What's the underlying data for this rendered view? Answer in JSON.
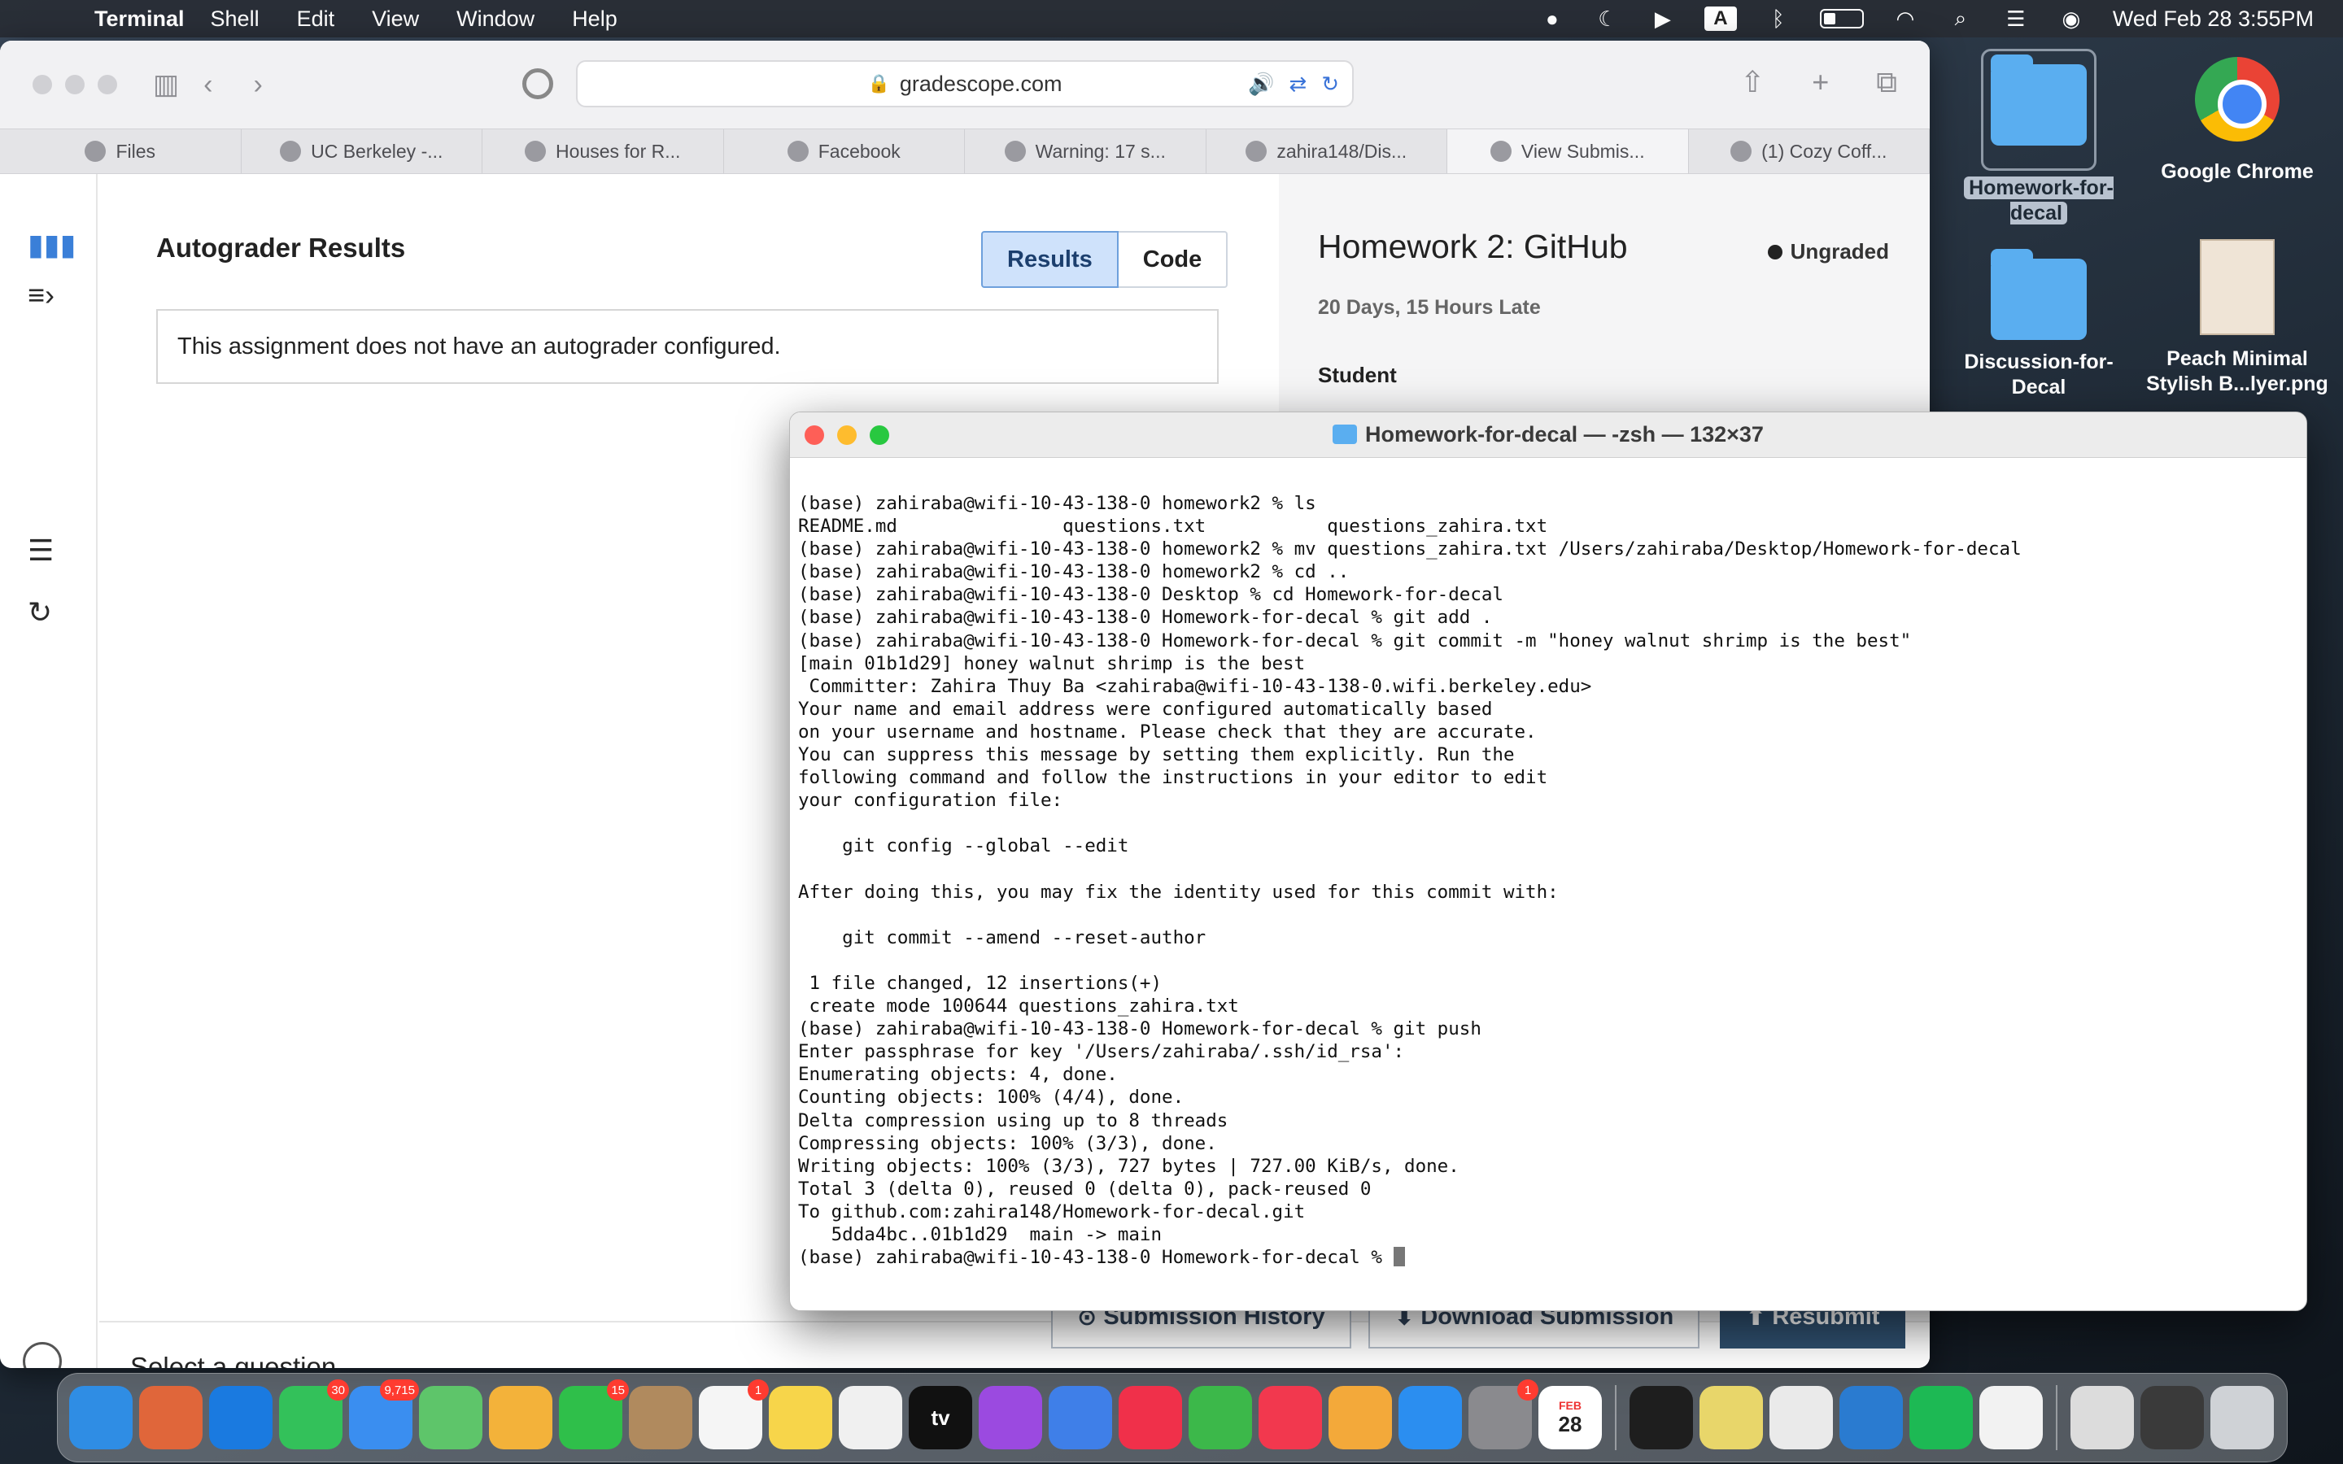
{
  "menubar": {
    "app_name": "Terminal",
    "menus": [
      "Shell",
      "Edit",
      "View",
      "Window",
      "Help"
    ],
    "clock": "Wed Feb 28  3:55PM"
  },
  "browser": {
    "url": "gradescope.com",
    "tabs": [
      "Files",
      "UC Berkeley -...",
      "Houses for R...",
      "Facebook",
      "Warning: 17 s...",
      "zahira148/Dis...",
      "View Submis...",
      "(1) Cozy Coff..."
    ]
  },
  "gradescope": {
    "autograder_heading": "Autograder Results",
    "results_tab": "Results",
    "code_tab": "Code",
    "notice": "This assignment does not have an autograder configured.",
    "homework_title": "Homework 2: GitHub",
    "grade_status": "Ungraded",
    "late_text": "20 Days, 15 Hours Late",
    "student_label": "Student",
    "select_question": "Select a question.",
    "submission_history": "Submission History",
    "download_submission": "Download Submission",
    "resubmit": "Resubmit"
  },
  "desktop": {
    "icons": [
      {
        "label": "Homework-for-decal"
      },
      {
        "label": "Google Chrome"
      },
      {
        "label": "Discussion-for-Decal"
      },
      {
        "label": "Peach Minimal Stylish B...lyer.png"
      }
    ]
  },
  "terminal": {
    "title": "Homework-for-decal — -zsh — 132×37",
    "lines": [
      "(base) zahiraba@wifi-10-43-138-0 homework2 % ls",
      "README.md               questions.txt           questions_zahira.txt",
      "(base) zahiraba@wifi-10-43-138-0 homework2 % mv questions_zahira.txt /Users/zahiraba/Desktop/Homework-for-decal",
      "(base) zahiraba@wifi-10-43-138-0 homework2 % cd ..",
      "(base) zahiraba@wifi-10-43-138-0 Desktop % cd Homework-for-decal",
      "(base) zahiraba@wifi-10-43-138-0 Homework-for-decal % git add .",
      "(base) zahiraba@wifi-10-43-138-0 Homework-for-decal % git commit -m \"honey walnut shrimp is the best\"",
      "[main 01b1d29] honey walnut shrimp is the best",
      " Committer: Zahira Thuy Ba <zahiraba@wifi-10-43-138-0.wifi.berkeley.edu>",
      "Your name and email address were configured automatically based",
      "on your username and hostname. Please check that they are accurate.",
      "You can suppress this message by setting them explicitly. Run the",
      "following command and follow the instructions in your editor to edit",
      "your configuration file:",
      "",
      "    git config --global --edit",
      "",
      "After doing this, you may fix the identity used for this commit with:",
      "",
      "    git commit --amend --reset-author",
      "",
      " 1 file changed, 12 insertions(+)",
      " create mode 100644 questions_zahira.txt",
      "(base) zahiraba@wifi-10-43-138-0 Homework-for-decal % git push",
      "Enter passphrase for key '/Users/zahiraba/.ssh/id_rsa':",
      "Enumerating objects: 4, done.",
      "Counting objects: 100% (4/4), done.",
      "Delta compression using up to 8 threads",
      "Compressing objects: 100% (3/3), done.",
      "Writing objects: 100% (3/3), 727 bytes | 727.00 KiB/s, done.",
      "Total 3 (delta 0), reused 0 (delta 0), pack-reused 0",
      "To github.com:zahira148/Homework-for-decal.git",
      "   5dda4bc..01b1d29  main -> main"
    ],
    "prompt": "(base) zahiraba@wifi-10-43-138-0 Homework-for-decal % "
  },
  "dock": {
    "apps": [
      {
        "name": "Finder",
        "color": "#2f8de4"
      },
      {
        "name": "Launchpad",
        "color": "#e0663a"
      },
      {
        "name": "Safari",
        "color": "#1a7ae0"
      },
      {
        "name": "Messages",
        "color": "#33c15a",
        "badge": "30"
      },
      {
        "name": "Mail",
        "color": "#3a8ef0",
        "badge": "9,715"
      },
      {
        "name": "Maps",
        "color": "#5ec56a"
      },
      {
        "name": "Photos",
        "color": "#f3b23a"
      },
      {
        "name": "FaceTime",
        "color": "#2fbf4a",
        "badge": "15"
      },
      {
        "name": "Contacts",
        "color": "#b08a5e"
      },
      {
        "name": "Reminders",
        "color": "#f5f5f5",
        "badge": "1"
      },
      {
        "name": "Notes",
        "color": "#f7d54a"
      },
      {
        "name": "Freeform",
        "color": "#f0f0f0"
      },
      {
        "name": "TV",
        "color": "#111111",
        "text": "tv"
      },
      {
        "name": "Podcasts",
        "color": "#9b4ae0"
      },
      {
        "name": "Keynote",
        "color": "#3f7fe8"
      },
      {
        "name": "News",
        "color": "#f0304a"
      },
      {
        "name": "Numbers",
        "color": "#3cb84a"
      },
      {
        "name": "Music",
        "color": "#f2384e"
      },
      {
        "name": "Pages",
        "color": "#f3a93a"
      },
      {
        "name": "App Store",
        "color": "#2b8ef0"
      },
      {
        "name": "System Settings",
        "color": "#8a8a8e",
        "badge": "1"
      },
      {
        "name": "Calendar",
        "color": "#ffffff",
        "text": "28",
        "month": "FEB"
      },
      {
        "name": "Terminal",
        "color": "#1e1e1e"
      },
      {
        "name": "Stickies",
        "color": "#e8d66a"
      },
      {
        "name": "Google Chrome",
        "color": "#eaeaea"
      },
      {
        "name": "Visual Studio Code",
        "color": "#2a7bd0"
      },
      {
        "name": "Spotify",
        "color": "#1db954"
      },
      {
        "name": "TextEdit",
        "color": "#f2f2f2"
      },
      {
        "name": "Documents",
        "color": "#dcdcdc"
      },
      {
        "name": "Screenshots",
        "color": "#3a3a3a"
      },
      {
        "name": "Trash",
        "color": "#cfd2d6"
      }
    ]
  }
}
